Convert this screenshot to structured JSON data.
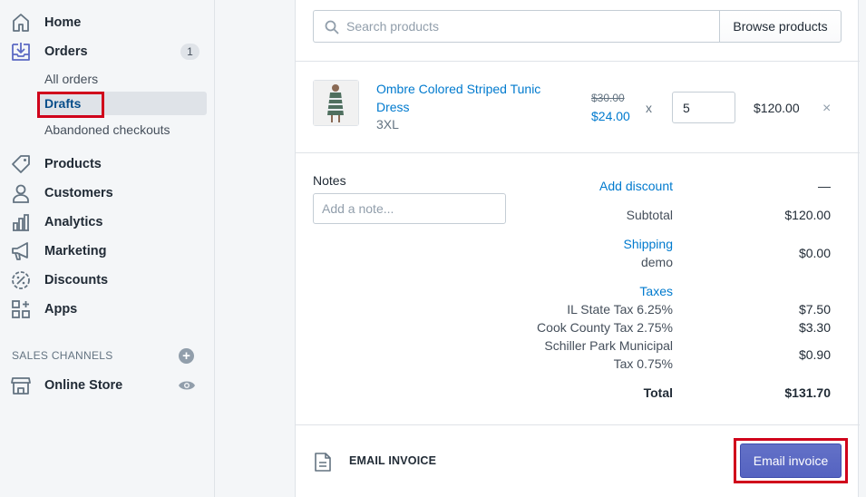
{
  "sidebar": {
    "items": [
      {
        "label": "Home",
        "icon": "home-icon"
      },
      {
        "label": "Orders",
        "icon": "orders-icon",
        "badge": "1"
      },
      {
        "label": "Products",
        "icon": "tag-icon"
      },
      {
        "label": "Customers",
        "icon": "person-icon"
      },
      {
        "label": "Analytics",
        "icon": "bar-chart-icon"
      },
      {
        "label": "Marketing",
        "icon": "megaphone-icon"
      },
      {
        "label": "Discounts",
        "icon": "discount-icon"
      },
      {
        "label": "Apps",
        "icon": "apps-icon"
      }
    ],
    "orders_sub": [
      "All orders",
      "Drafts",
      "Abandoned checkouts"
    ],
    "sales_channels_heading": "SALES CHANNELS",
    "online_store": "Online Store"
  },
  "search": {
    "placeholder": "Search products",
    "browse_label": "Browse products"
  },
  "line_item": {
    "title": "Ombre Colored Striped Tunic Dress",
    "variant": "3XL",
    "original_price": "$30.00",
    "price": "$24.00",
    "times": "x",
    "quantity": "5",
    "total": "$120.00",
    "remove": "×"
  },
  "notes": {
    "label": "Notes",
    "placeholder": "Add a note..."
  },
  "summary": {
    "add_discount": "Add discount",
    "discount_value": "—",
    "subtotal_label": "Subtotal",
    "subtotal_value": "$120.00",
    "shipping_label": "Shipping",
    "shipping_method": "demo",
    "shipping_value": "$0.00",
    "taxes_label": "Taxes",
    "tax1_label": "IL State Tax 6.25%",
    "tax1_value": "$7.50",
    "tax2_label": "Cook County Tax 2.75%",
    "tax2_value": "$3.30",
    "tax3_label_a": "Schiller Park Municipal",
    "tax3_label_b": "Tax 0.75%",
    "tax3_value": "$0.90",
    "total_label": "Total",
    "total_value": "$131.70"
  },
  "invoice": {
    "heading": "EMAIL INVOICE",
    "button": "Email invoice"
  },
  "colors": {
    "accent": "#5c6ac4",
    "link": "#007ace",
    "highlight": "#d0021b"
  }
}
